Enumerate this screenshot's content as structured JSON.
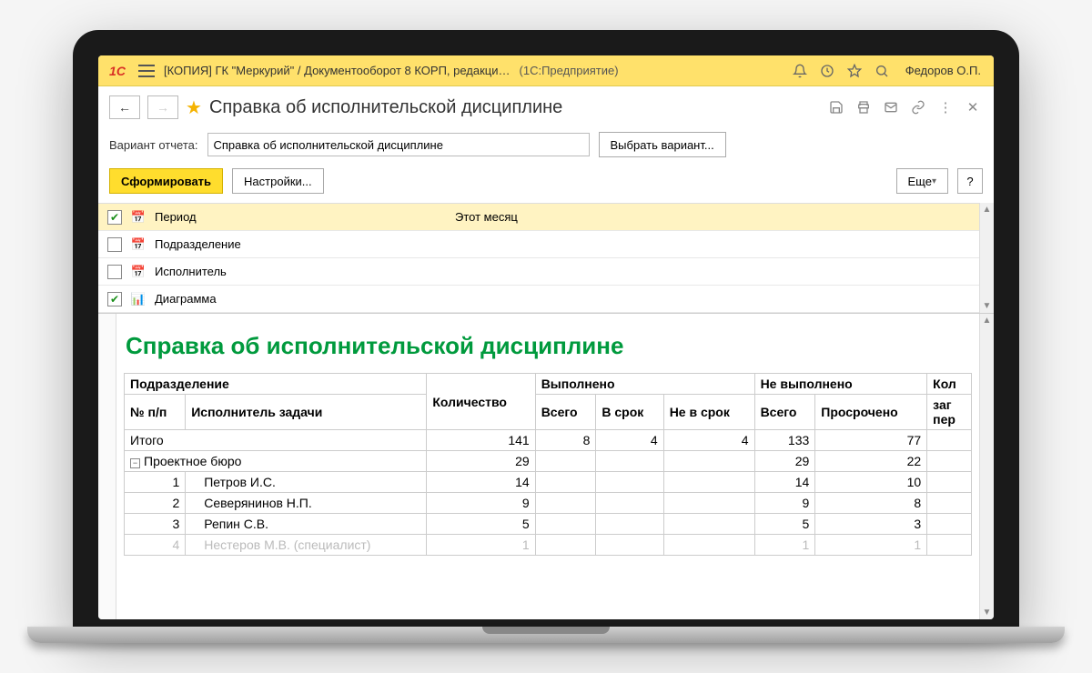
{
  "titlebar": {
    "app_title": "[КОПИЯ] ГК \"Меркурий\" / Документооборот 8 КОРП, редакци…",
    "platform": "(1С:Предприятие)",
    "user": "Федоров О.П."
  },
  "doc": {
    "title": "Справка об исполнительской дисциплине"
  },
  "variant": {
    "label": "Вариант отчета:",
    "value": "Справка об исполнительской дисциплине",
    "select_label": "Выбрать вариант..."
  },
  "actions": {
    "generate": "Сформировать",
    "settings": "Настройки...",
    "more": "Еще",
    "help": "?"
  },
  "params": [
    {
      "checked": true,
      "icon": "date",
      "name": "Период",
      "value": "Этот месяц",
      "selected": true
    },
    {
      "checked": false,
      "icon": "date",
      "name": "Подразделение",
      "value": ""
    },
    {
      "checked": false,
      "icon": "date",
      "name": "Исполнитель",
      "value": ""
    },
    {
      "checked": true,
      "icon": "chart",
      "name": "Диаграмма",
      "value": ""
    }
  ],
  "report": {
    "title": "Справка об исполнительской дисциплине",
    "headers": {
      "dept": "Подразделение",
      "qty": "Количество",
      "done": "Выполнено",
      "not_done": "Не выполнено",
      "col_extra": "Кол",
      "num": "№ п/п",
      "performer": "Исполнитель задачи",
      "total_h": "Всего",
      "in_time": "В срок",
      "not_in_time": "Не в срок",
      "overdue": "Просрочено",
      "extra2": "заг",
      "extra3": "пер"
    },
    "totals_label": "Итого",
    "totals": {
      "qty": 141,
      "done_total": 8,
      "in_time": 4,
      "not_in_time": 4,
      "nd_total": 133,
      "overdue": 77
    },
    "group": {
      "name": "Проектное бюро",
      "qty": 29,
      "nd_total": 29,
      "overdue": 22
    },
    "rows": [
      {
        "n": 1,
        "name": "Петров И.С.",
        "qty": 14,
        "nd_total": 14,
        "overdue": 10,
        "dim": false
      },
      {
        "n": 2,
        "name": "Северянинов Н.П.",
        "qty": 9,
        "nd_total": 9,
        "overdue": 8,
        "dim": false
      },
      {
        "n": 3,
        "name": "Репин С.В.",
        "qty": 5,
        "nd_total": 5,
        "overdue": 3,
        "dim": false
      },
      {
        "n": 4,
        "name": "Нестеров М.В. (специалист)",
        "qty": 1,
        "nd_total": 1,
        "overdue": 1,
        "dim": true
      }
    ]
  }
}
